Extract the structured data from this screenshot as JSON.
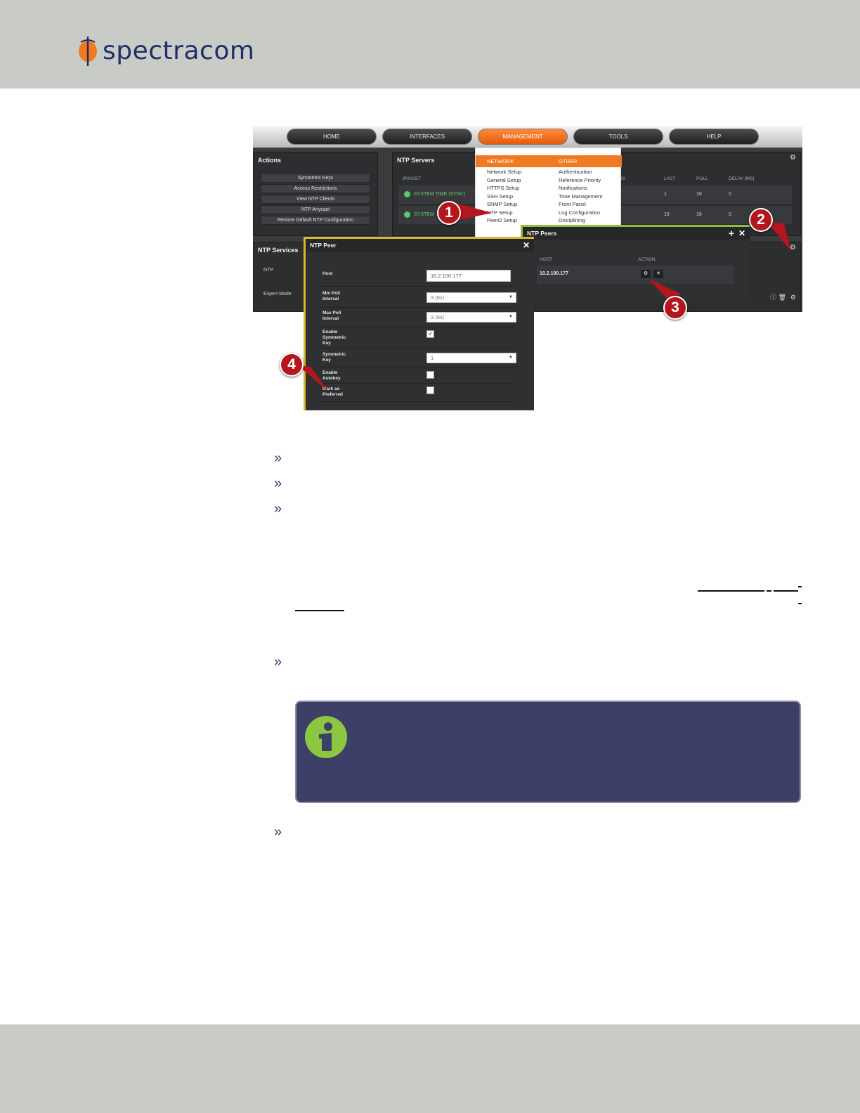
{
  "brand": {
    "name": "spectracom",
    "accent": "#f07a22",
    "text_color": "#1f2e6b"
  },
  "nav": {
    "tabs": [
      {
        "label": "HOME"
      },
      {
        "label": "INTERFACES"
      },
      {
        "label": "MANAGEMENT"
      },
      {
        "label": "TOOLS"
      },
      {
        "label": "HELP"
      }
    ],
    "active": "MANAGEMENT"
  },
  "actions": {
    "title": "Actions",
    "buttons": [
      {
        "label": "Symmetric Keys"
      },
      {
        "label": "Access Restrictions"
      },
      {
        "label": "View NTP Clients"
      },
      {
        "label": "NTP Anycast"
      },
      {
        "label": "Restore Default NTP Configuration"
      }
    ]
  },
  "ntp_servers": {
    "title": "NTP Servers",
    "headers": [
      "IP/HOST",
      "US",
      "LAST",
      "POLL",
      "DELAY (MS)"
    ],
    "rows": [
      {
        "host": "SYSTEM TIME (SYNC)",
        "last": "1",
        "poll": "16",
        "delay": "0"
      },
      {
        "host": "SYSTEM",
        "last": "16",
        "poll": "16",
        "delay": "0"
      }
    ]
  },
  "ntp_services": {
    "title": "NTP Services",
    "rows": [
      "NTP",
      "Expert Mode"
    ]
  },
  "menu": {
    "network_header": "NETWORK",
    "other_header": "OTHER",
    "network": [
      "Network Setup",
      "General Setup",
      "HTTPS Setup",
      "SSH Setup",
      "SNMP Setup",
      "NTP Setup",
      "PeerD Setup"
    ],
    "other": [
      "Authentication",
      "Reference Priority",
      "Notifications",
      "Time Management",
      "Front Panel",
      "Log Configuration",
      "Disciplining"
    ]
  },
  "ntp_peers": {
    "title": "NTP Peers",
    "add": "+",
    "close": "✕",
    "headers": [
      "HOST",
      "ACTION"
    ],
    "rows": [
      {
        "host": "10.2.100.177"
      }
    ]
  },
  "ntp_peer": {
    "title": "NTP Peer",
    "close": "✕",
    "fields": {
      "host_label": "Host",
      "host_value": "10.2.100.177",
      "min_poll_label": "Min Poll Interval",
      "min_poll_value": "3 (8s)",
      "max_poll_label": "Max Poll Interval",
      "max_poll_value": "3 (8s)",
      "enable_symmetric_label": "Enable Symmetric Key",
      "enable_symmetric_checked": true,
      "symmetric_key_label": "Symmetric Key",
      "symmetric_key_value": "1",
      "enable_autokey_label": "Enable Autokey",
      "enable_autokey_checked": false,
      "mark_preferred_label": "Mark as Preferred",
      "mark_preferred_checked": false
    }
  },
  "callouts": [
    "1",
    "2",
    "3",
    "4"
  ],
  "bullets": [
    "»",
    "»",
    "»",
    "»",
    "»"
  ],
  "icons": {
    "info": "info-icon",
    "gear": "gear-icon",
    "close": "close-icon"
  },
  "colors": {
    "band": "#c9ccc6",
    "note_bg": "#3c4066",
    "info_green": "#8dc63f",
    "callout_red": "#b3161c"
  }
}
